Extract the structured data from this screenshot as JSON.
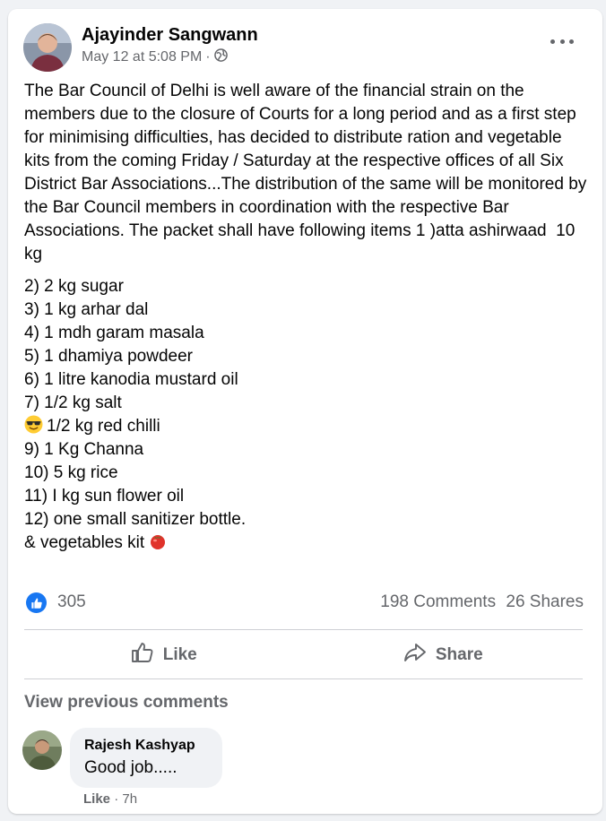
{
  "post": {
    "author": "Ajayinder Sangwann",
    "date": "May 12 at 5:08 PM",
    "separator": "·",
    "privacy_icon": "globe-icon",
    "more_icon": "more-options-icon",
    "intro": "The Bar Council of Delhi is well aware of the financial strain on the members due to the closure of Courts for a long period and as a first step for minimising difficulties, has decided to distribute ration and vegetable kits from the coming Friday / Saturday at the respective offices of all Six District Bar Associations...The distribution of the same will be monitored by the Bar Council members in coordination with the respective Bar Associations. The packet shall have following items 1 )atta ashirwaad  10 kg",
    "items": [
      "2) 2 kg sugar",
      "3) 1 kg arhar dal",
      "4) 1 mdh garam masala",
      "5) 1 dhamiya powdeer",
      "6) 1 litre kanodia mustard oil",
      "7) 1/2 kg salt"
    ],
    "item_emoji": {
      "icon": "sunglasses-emoji-icon",
      "text": "1/2 kg red chilli"
    },
    "items_after": [
      "9) 1 Kg Channa",
      "10) 5 kg rice",
      "11) I kg sun flower oil",
      "12) one small sanitizer bottle."
    ],
    "closing": {
      "text": "& vegetables kit",
      "icon": "tomato-emoji-icon"
    }
  },
  "stats": {
    "like_count": "305",
    "comments": "198 Comments",
    "shares": "26 Shares"
  },
  "actions": {
    "like_label": "Like",
    "share_label": "Share"
  },
  "comments_section": {
    "view_previous": "View previous comments",
    "comment": {
      "author": "Rajesh Kashyap",
      "text": "Good job.....",
      "like_label": "Like",
      "separator": "·",
      "time": "7h"
    }
  },
  "colors": {
    "brand_blue": "#1877f2",
    "secondary_text": "#65676b",
    "background": "#f0f2f5"
  }
}
